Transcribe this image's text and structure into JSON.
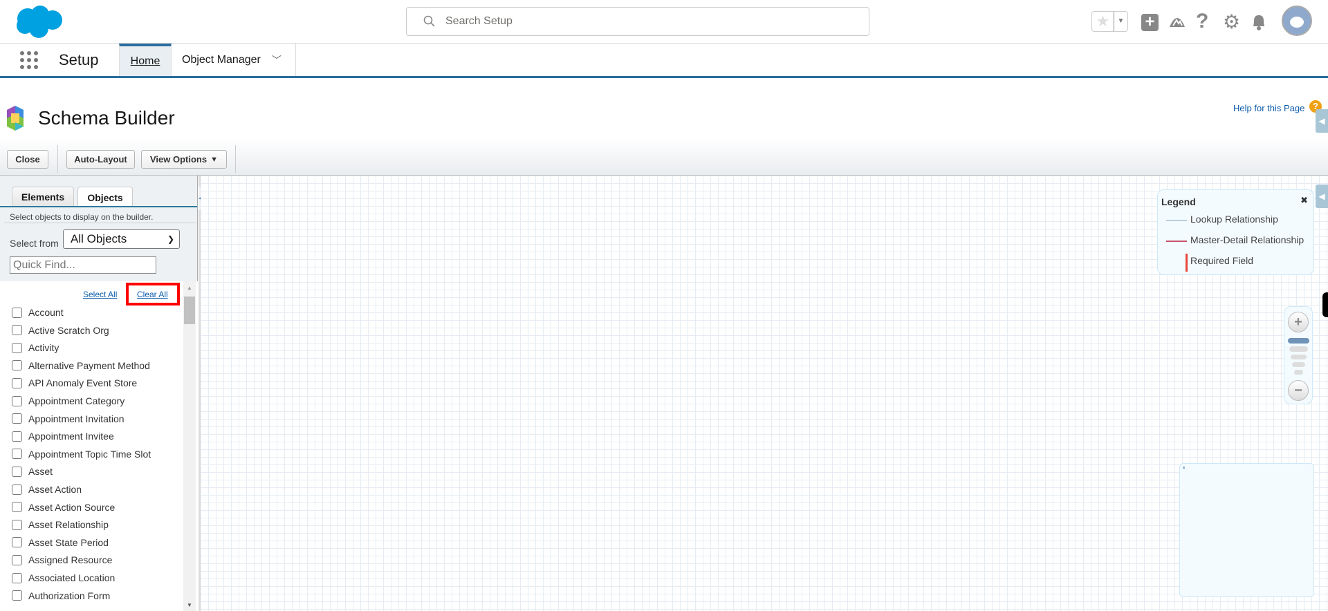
{
  "header": {
    "search_placeholder": "Search Setup"
  },
  "nav": {
    "app_name": "Setup",
    "tabs": [
      {
        "label": "Home",
        "active": true
      },
      {
        "label": "Object Manager"
      }
    ]
  },
  "page": {
    "title": "Schema Builder",
    "help_link": "Help for this Page"
  },
  "toolbar": {
    "close": "Close",
    "auto_layout": "Auto-Layout",
    "view_options": "View Options"
  },
  "sidebar": {
    "tabs": [
      {
        "label": "Elements"
      },
      {
        "label": "Objects",
        "active": true
      }
    ],
    "description": "Select objects to display on the builder.",
    "select_from_label": "Select from",
    "select_from_value": "All Objects",
    "quick_find_placeholder": "Quick Find...",
    "select_all": "Select All",
    "clear_all": "Clear All",
    "highlight_color": "#ff0000",
    "objects": [
      "Account",
      "Active Scratch Org",
      "Activity",
      "Alternative Payment Method",
      "API Anomaly Event Store",
      "Appointment Category",
      "Appointment Invitation",
      "Appointment Invitee",
      "Appointment Topic Time Slot",
      "Asset",
      "Asset Action",
      "Asset Action Source",
      "Asset Relationship",
      "Asset State Period",
      "Assigned Resource",
      "Associated Location",
      "Authorization Form"
    ]
  },
  "legend": {
    "title": "Legend",
    "items": [
      {
        "label": "Lookup Relationship",
        "color": "#b9cfdc"
      },
      {
        "label": "Master-Detail Relationship",
        "color": "#c9506a"
      },
      {
        "label": "Required Field",
        "color": "#e8453c"
      }
    ]
  },
  "colors": {
    "brand": "#00a1e0",
    "nav_accent": "#2a6e9e",
    "link": "#0b5cab"
  }
}
